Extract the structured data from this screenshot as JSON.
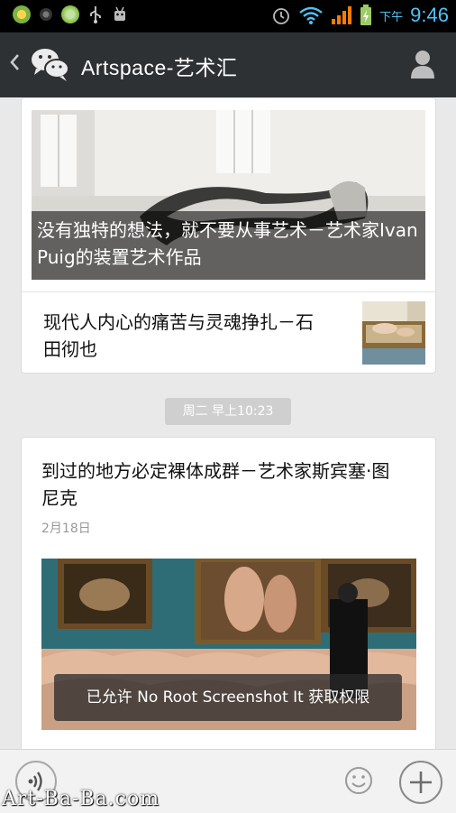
{
  "status_bar": {
    "time": "9:46",
    "ampm": "下午",
    "left_icons": [
      "android-icon",
      "circle-icon",
      "bug-icon",
      "usb-icon",
      "robot-icon"
    ],
    "right_icons": [
      "alarm-icon",
      "wifi-icon",
      "signal-icon",
      "battery-icon"
    ]
  },
  "app_bar": {
    "title": "Artspace-艺术汇",
    "back_icon": "chevron-left-icon",
    "logo_icon": "wechat-icon",
    "profile_icon": "person-icon"
  },
  "messages": {
    "card1": {
      "main_caption": "没有独特的想法，就不要从事艺术－艺术家Ivan Puig的装置艺术作品",
      "sub_title": "现代人内心的痛苦与灵魂挣扎－石田彻也"
    },
    "time_chip": "周二 早上10:23",
    "card2": {
      "title": "到过的地方必定裸体成群－艺术家斯宾塞·图尼克",
      "date": "2月18日"
    }
  },
  "toast": "已允许 No Root Screenshot It 获取权限",
  "bottom_bar": {
    "voice_icon": "voice-icon",
    "emoji_icon": "smiley-icon",
    "plus_icon": "plus-icon"
  },
  "watermark": "Art-Ba-Ba.com",
  "colors": {
    "app_bar": "#2e3134",
    "status_bar": "#000000",
    "clock": "#4fc3f7",
    "background": "#e9e9e9"
  }
}
